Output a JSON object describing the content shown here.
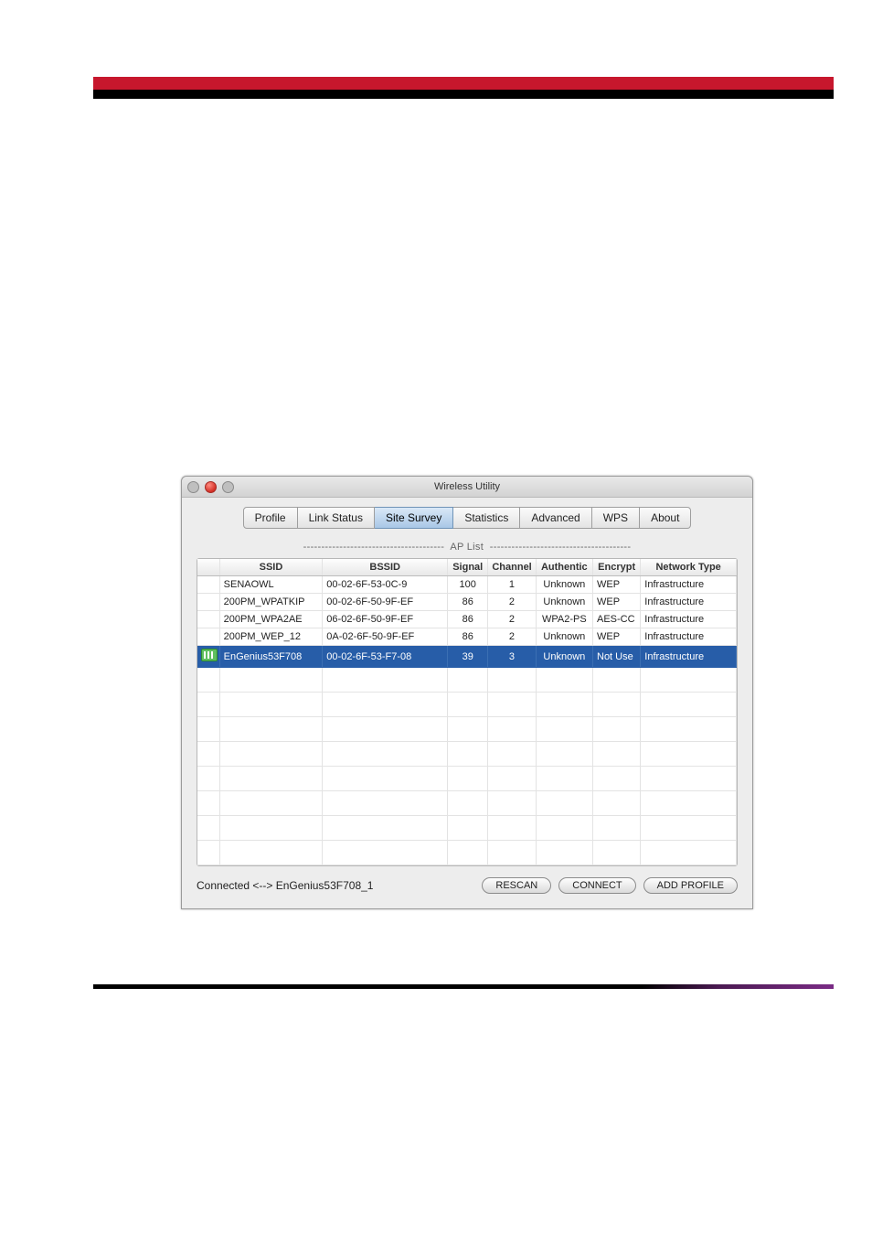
{
  "window": {
    "title": "Wireless Utility"
  },
  "tabs": [
    {
      "label": "Profile",
      "active": false
    },
    {
      "label": "Link Status",
      "active": false
    },
    {
      "label": "Site Survey",
      "active": true
    },
    {
      "label": "Statistics",
      "active": false
    },
    {
      "label": "Advanced",
      "active": false
    },
    {
      "label": "WPS",
      "active": false
    },
    {
      "label": "About",
      "active": false
    }
  ],
  "ap_list_label": "---------------------------------------  AP List  ---------------------------------------",
  "columns": {
    "ssid": "SSID",
    "bssid": "BSSID",
    "signal": "Signal",
    "channel": "Channel",
    "auth": "Authentic",
    "encrypt": "Encrypt",
    "nettype": "Network Type"
  },
  "rows": [
    {
      "connected": false,
      "ssid": "SENAOWL",
      "bssid": "00-02-6F-53-0C-9",
      "signal": "100",
      "channel": "1",
      "auth": "Unknown",
      "encrypt": "WEP",
      "nettype": "Infrastructure",
      "selected": false
    },
    {
      "connected": false,
      "ssid": "200PM_WPATKIP",
      "bssid": "00-02-6F-50-9F-EF",
      "signal": "86",
      "channel": "2",
      "auth": "Unknown",
      "encrypt": "WEP",
      "nettype": "Infrastructure",
      "selected": false
    },
    {
      "connected": false,
      "ssid": "200PM_WPA2AE",
      "bssid": "06-02-6F-50-9F-EF",
      "signal": "86",
      "channel": "2",
      "auth": "WPA2-PS",
      "encrypt": "AES-CC",
      "nettype": "Infrastructure",
      "selected": false
    },
    {
      "connected": false,
      "ssid": "200PM_WEP_12",
      "bssid": "0A-02-6F-50-9F-EF",
      "signal": "86",
      "channel": "2",
      "auth": "Unknown",
      "encrypt": "WEP",
      "nettype": "Infrastructure",
      "selected": false
    },
    {
      "connected": true,
      "ssid": "EnGenius53F708",
      "bssid": "00-02-6F-53-F7-08",
      "signal": "39",
      "channel": "3",
      "auth": "Unknown",
      "encrypt": "Not Use",
      "nettype": "Infrastructure",
      "selected": true
    }
  ],
  "empty_rows": 8,
  "status": "Connected <--> EnGenius53F708_1",
  "buttons": {
    "rescan": "RESCAN",
    "connect": "CONNECT",
    "add_profile": "ADD PROFILE"
  }
}
